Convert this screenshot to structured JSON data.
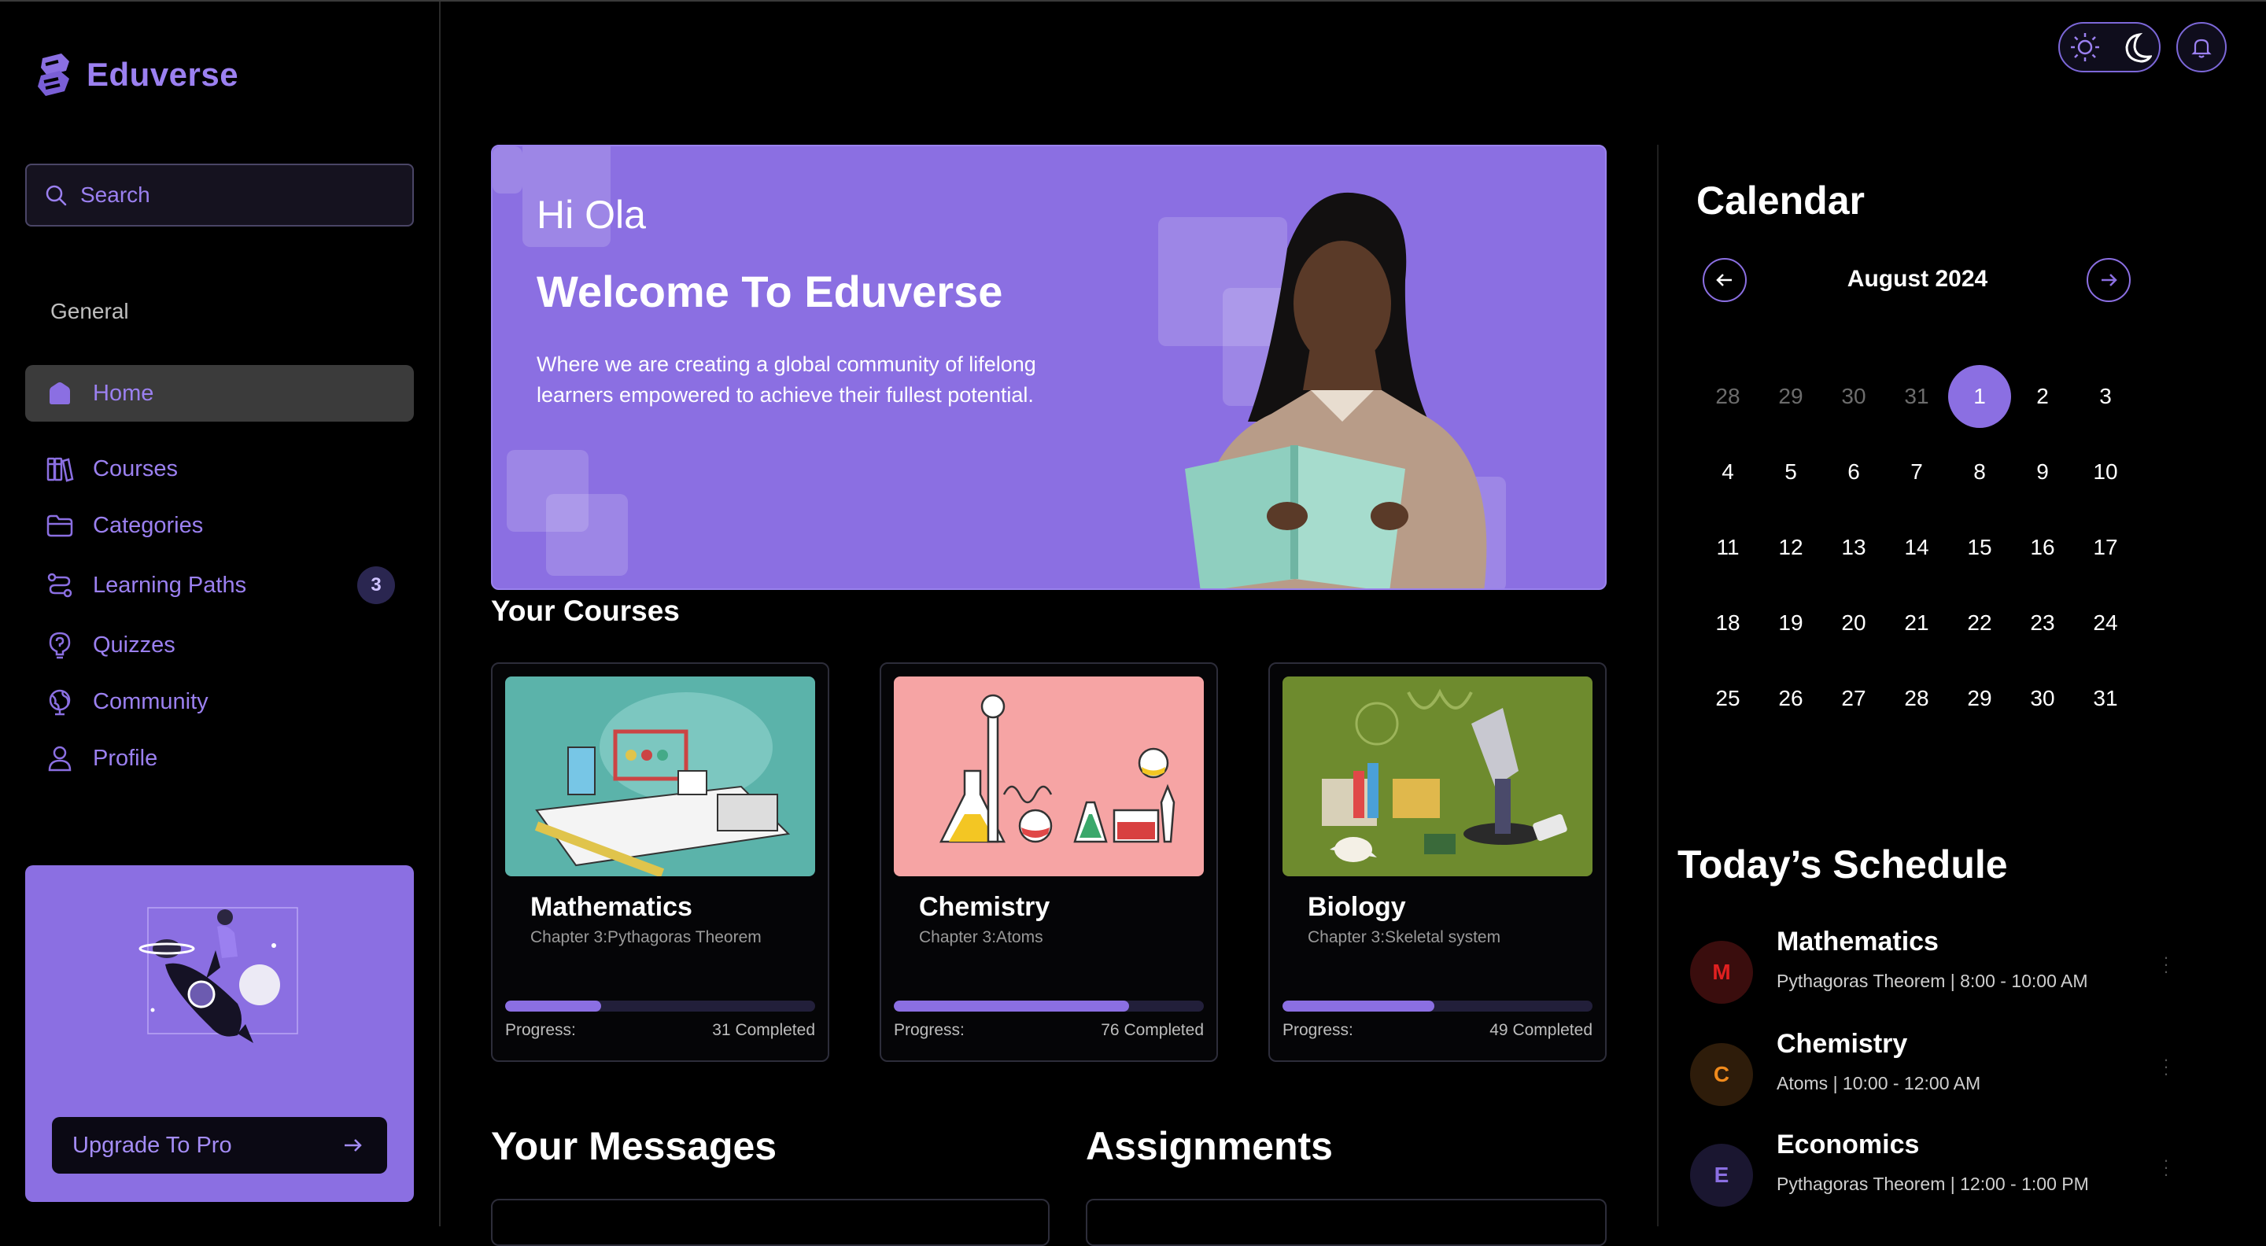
{
  "app": {
    "name": "Eduverse"
  },
  "search": {
    "placeholder": "Search"
  },
  "sidebar": {
    "section_label": "General",
    "items": [
      {
        "label": "Home",
        "icon": "home-icon",
        "active": true
      },
      {
        "label": "Courses",
        "icon": "books-icon"
      },
      {
        "label": "Categories",
        "icon": "folder-icon"
      },
      {
        "label": "Learning Paths",
        "icon": "route-icon",
        "badge": "3"
      },
      {
        "label": "Quizzes",
        "icon": "question-icon"
      },
      {
        "label": "Community",
        "icon": "globe-icon"
      },
      {
        "label": "Profile",
        "icon": "user-icon"
      }
    ],
    "upgrade": {
      "label": "Upgrade To Pro"
    }
  },
  "hero": {
    "greeting": "Hi Ola",
    "title": "Welcome To Eduverse",
    "description": "Where we are creating a global community of lifelong learners empowered to achieve their fullest potential."
  },
  "courses": {
    "heading": "Your Courses",
    "progress_label": "Progress:",
    "items": [
      {
        "title": "Mathematics",
        "chapter": "Chapter 3:Pythagoras Theorem",
        "completed_text": "31 Completed",
        "progress": 0.31,
        "image_bg": "#5bb3aa"
      },
      {
        "title": "Chemistry",
        "chapter": "Chapter 3:Atoms",
        "completed_text": "76 Completed",
        "progress": 0.76,
        "image_bg": "#f6a4a4"
      },
      {
        "title": "Biology",
        "chapter": "Chapter 3:Skeletal system",
        "completed_text": "49 Completed",
        "progress": 0.49,
        "image_bg": "#6e8b2e"
      }
    ]
  },
  "messages": {
    "heading": "Your Messages"
  },
  "assignments": {
    "heading": "Assignments"
  },
  "calendar": {
    "title": "Calendar",
    "month_label": "August 2024",
    "days": [
      "28",
      "29",
      "30",
      "31",
      "1",
      "2",
      "3",
      "4",
      "5",
      "6",
      "7",
      "8",
      "9",
      "10",
      "11",
      "12",
      "13",
      "14",
      "15",
      "16",
      "17",
      "18",
      "19",
      "20",
      "21",
      "22",
      "23",
      "24",
      "25",
      "26",
      "27",
      "28",
      "29",
      "30",
      "31"
    ],
    "muted_count": 4,
    "today_index": 4
  },
  "schedule": {
    "title": "Today’s Schedule",
    "items": [
      {
        "initial": "M",
        "name": "Mathematics",
        "meta": "Pythagoras Theorem | 8:00 - 10:00 AM",
        "color": "#e02020",
        "bg": "#3a0d0d"
      },
      {
        "initial": "C",
        "name": "Chemistry",
        "meta": "Atoms | 10:00 - 12:00 AM",
        "color": "#f08a1c",
        "bg": "#2e1c0a"
      },
      {
        "initial": "E",
        "name": "Economics",
        "meta": "Pythagoras Theorem | 12:00 - 1:00 PM",
        "color": "#8b6fe2",
        "bg": "#1a1630"
      }
    ]
  },
  "colors": {
    "accent": "#8b6fe2",
    "background": "#000000"
  }
}
